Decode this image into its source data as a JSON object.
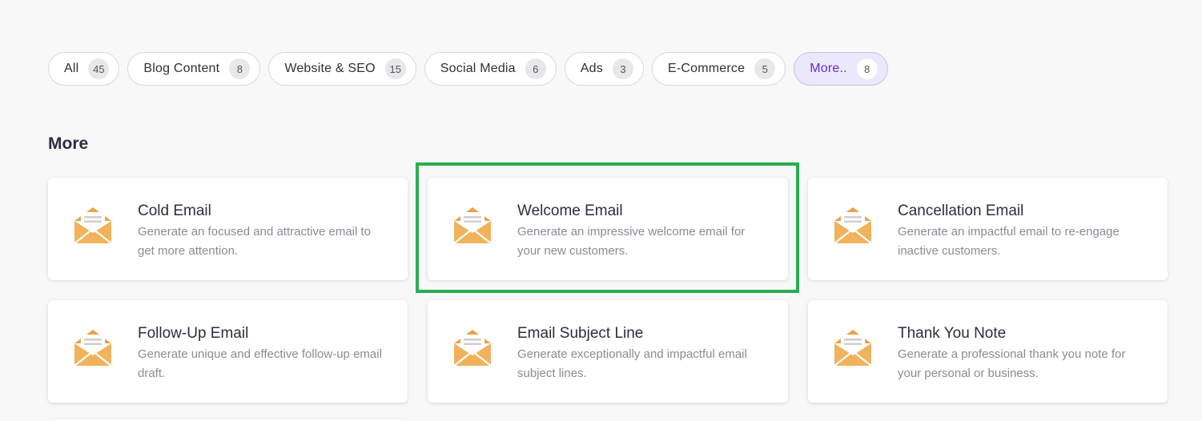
{
  "filters": [
    {
      "label": "All",
      "count": "45",
      "active": false
    },
    {
      "label": "Blog Content",
      "count": "8",
      "active": false
    },
    {
      "label": "Website & SEO",
      "count": "15",
      "active": false
    },
    {
      "label": "Social Media",
      "count": "6",
      "active": false
    },
    {
      "label": "Ads",
      "count": "3",
      "active": false
    },
    {
      "label": "E-Commerce",
      "count": "5",
      "active": false
    },
    {
      "label": "More..",
      "count": "8",
      "active": true
    }
  ],
  "section": {
    "title": "More"
  },
  "cards": [
    {
      "icon": "envelope-icon",
      "title": "Cold Email",
      "description": "Generate an focused and attractive email to get more attention."
    },
    {
      "icon": "envelope-icon",
      "title": "Welcome Email",
      "description": "Generate an impressive welcome email for your new customers."
    },
    {
      "icon": "envelope-icon",
      "title": "Cancellation Email",
      "description": "Generate an impactful email to re-engage inactive customers."
    },
    {
      "icon": "envelope-icon",
      "title": "Follow-Up Email",
      "description": "Generate unique and effective follow-up email draft."
    },
    {
      "icon": "envelope-icon",
      "title": "Email Subject Line",
      "description": "Generate exceptionally and impactful email subject lines."
    },
    {
      "icon": "envelope-icon",
      "title": "Thank You Note",
      "description": "Generate a professional thank you note for your personal or business."
    }
  ],
  "colors": {
    "accent": "#5b2bd9",
    "highlight": "#27ae4f",
    "envelope_body": "#f0b35c",
    "envelope_flap": "#e8a447"
  }
}
